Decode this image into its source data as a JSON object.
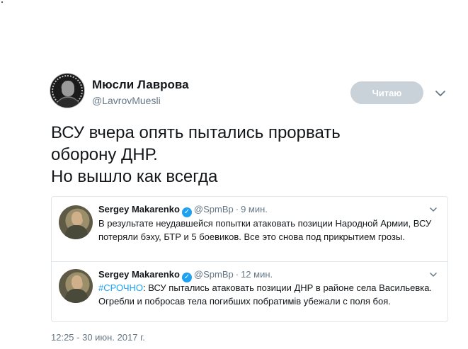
{
  "author": {
    "display_name": "Мюсли Лаврова",
    "handle": "@LavrovMuesli"
  },
  "follow_button": {
    "label": "Читаю"
  },
  "tweet": {
    "lines": [
      "ВСУ вчера опять пытались прорвать",
      "оборону ДНР.",
      "Но вышло как всегда"
    ],
    "timestamp": "12:25 - 30 июн. 2017 г."
  },
  "quoted_tweets": [
    {
      "name": "Sergey Makarenko",
      "handle": "@SpmBp",
      "time": "9 мин.",
      "text": "В результате неудавшейся попытки атаковать позиции Народной Армии, ВСУ потеряли бэху, БТР и 5 боевиков. Все это снова под прикрытием грозы."
    },
    {
      "name": "Sergey Makarenko",
      "handle": "@SpmBp",
      "time": "12 мин.",
      "hashtag": "#СРОЧНО",
      "text": ": ВСУ пытались атаковать позиции ДНР в районе села Васильевка. Огребли и побросав тела погибших побратимів убежали с поля боя."
    }
  ],
  "colors": {
    "link_blue": "#1da1f2",
    "muted_gray": "#657786",
    "button_gray": "#c9d2d9",
    "border": "#e1e8ed"
  },
  "icons": [
    "caret-down-icon",
    "verified-badge-icon",
    "avatar"
  ]
}
